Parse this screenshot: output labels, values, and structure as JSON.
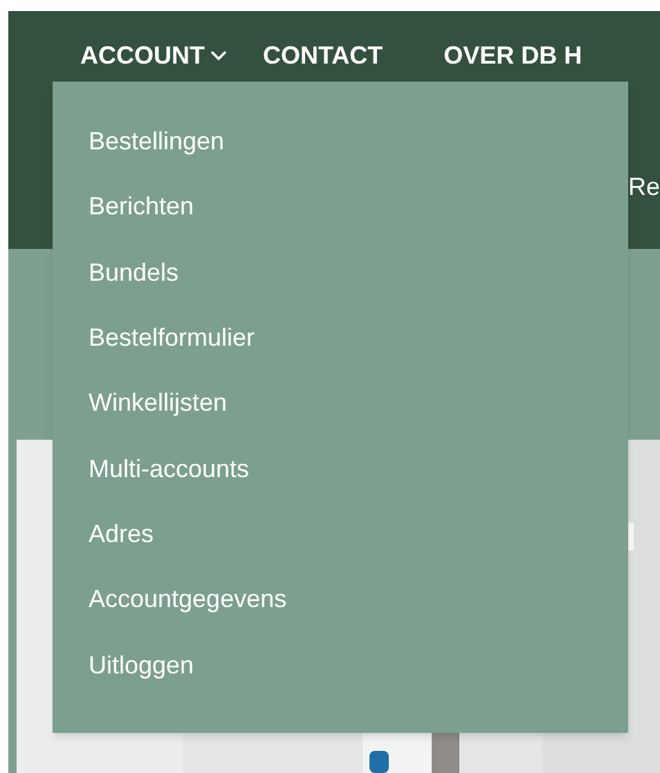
{
  "nav": [
    {
      "label": "ACCOUNT",
      "has_dropdown": true
    },
    {
      "label": "CONTACT",
      "has_dropdown": false
    },
    {
      "label": "OVER DB H",
      "has_dropdown": false
    }
  ],
  "subnav": [
    "Re"
  ],
  "dropdown": {
    "items": [
      "Bestellingen",
      "Berichten",
      "Bundels",
      "Bestelformulier",
      "Winkellijsten",
      "Multi-accounts",
      "Adres",
      "Accountgegevens",
      "Uitloggen"
    ]
  }
}
